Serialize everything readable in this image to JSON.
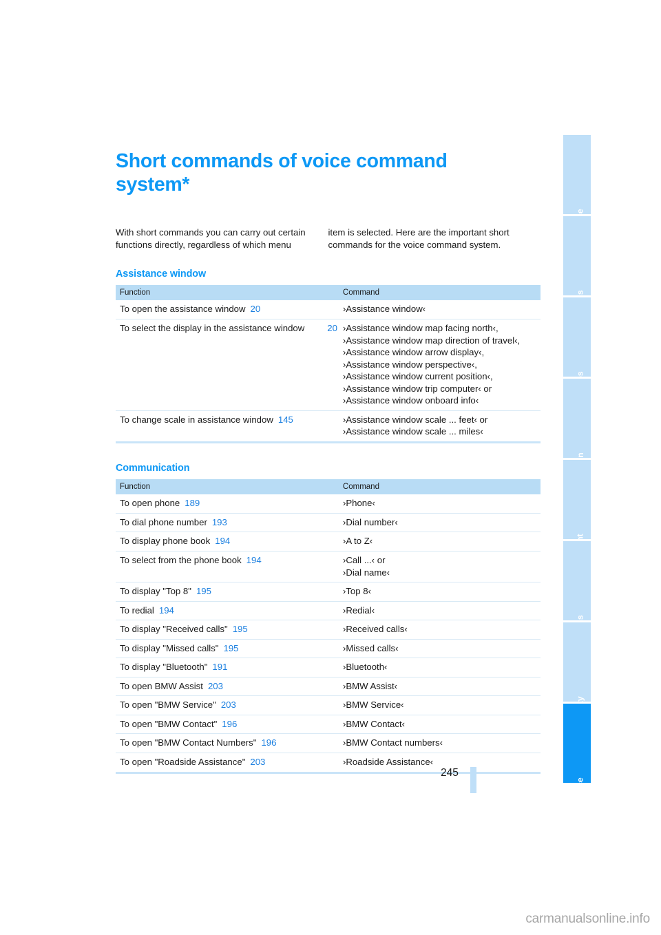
{
  "document": {
    "title": "Short commands of voice command system*",
    "page_number": "245",
    "watermark": "carmanualsonline.info"
  },
  "intro": {
    "left": "With short commands you can carry out certain functions directly, regardless of which menu",
    "right": "item is selected. Here are the important short commands for the voice command system."
  },
  "sections": [
    {
      "heading": "Assistance window",
      "table": {
        "columns": [
          "Function",
          "Command"
        ],
        "rows": [
          {
            "function": "To open the assistance window",
            "pageref": "20",
            "pageref_align": "inline",
            "commands": [
              "›Assistance window‹"
            ]
          },
          {
            "function": "To select the display in the assistance window",
            "pageref": "20",
            "pageref_align": "right",
            "commands": [
              "›Assistance window map facing north‹,",
              "›Assistance window map direction of travel‹,",
              "›Assistance window arrow display‹,",
              "›Assistance window perspective‹,",
              "›Assistance window current position‹,",
              "›Assistance window trip computer‹ or",
              "›Assistance window onboard info‹"
            ]
          },
          {
            "function": "To change scale in assistance window",
            "pageref": "145",
            "pageref_align": "inline",
            "commands": [
              "›Assistance window scale ... feet‹ or",
              "›Assistance window scale ... miles‹"
            ]
          }
        ]
      }
    },
    {
      "heading": "Communication",
      "table": {
        "columns": [
          "Function",
          "Command"
        ],
        "rows": [
          {
            "function": "To open phone",
            "pageref": "189",
            "pageref_align": "inline",
            "commands": [
              "›Phone‹"
            ]
          },
          {
            "function": "To dial phone number",
            "pageref": "193",
            "pageref_align": "inline",
            "commands": [
              "›Dial number‹"
            ]
          },
          {
            "function": "To display phone book",
            "pageref": "194",
            "pageref_align": "inline",
            "commands": [
              "›A to Z‹"
            ]
          },
          {
            "function": "To select from the phone book",
            "pageref": "194",
            "pageref_align": "inline",
            "commands": [
              "›Call ...‹ or",
              "›Dial name‹"
            ]
          },
          {
            "function": "To display \"Top 8\"",
            "pageref": "195",
            "pageref_align": "inline",
            "commands": [
              "›Top 8‹"
            ]
          },
          {
            "function": "To redial",
            "pageref": "194",
            "pageref_align": "inline",
            "commands": [
              "›Redial‹"
            ]
          },
          {
            "function": "To display \"Received calls\"",
            "pageref": "195",
            "pageref_align": "inline",
            "commands": [
              "›Received calls‹"
            ]
          },
          {
            "function": "To display \"Missed calls\"",
            "pageref": "195",
            "pageref_align": "inline",
            "commands": [
              "›Missed calls‹"
            ]
          },
          {
            "function": "To display \"Bluetooth\"",
            "pageref": "191",
            "pageref_align": "inline",
            "commands": [
              "›Bluetooth‹"
            ]
          },
          {
            "function": "To open BMW Assist",
            "pageref": "203",
            "pageref_align": "inline",
            "commands": [
              "›BMW Assist‹"
            ]
          },
          {
            "function": "To open \"BMW Service\"",
            "pageref": "203",
            "pageref_align": "inline",
            "commands": [
              "›BMW Service‹"
            ]
          },
          {
            "function": "To open \"BMW Contact\"",
            "pageref": "196",
            "pageref_align": "inline",
            "commands": [
              "›BMW Contact‹"
            ]
          },
          {
            "function": "To open \"BMW Contact Numbers\"",
            "pageref": "196",
            "pageref_align": "inline",
            "commands": [
              "›BMW Contact numbers‹"
            ]
          },
          {
            "function": "To open \"Roadside Assistance\"",
            "pageref": "203",
            "pageref_align": "inline",
            "commands": [
              "›Roadside Assistance‹"
            ]
          }
        ]
      }
    }
  ],
  "sidetabs": [
    {
      "label": "At a glance",
      "active": false
    },
    {
      "label": "Controls",
      "active": false
    },
    {
      "label": "Driving tips",
      "active": false
    },
    {
      "label": "Navigation",
      "active": false
    },
    {
      "label": "Entertainment",
      "active": false
    },
    {
      "label": "Communications",
      "active": false
    },
    {
      "label": "Mobility",
      "active": false
    },
    {
      "label": "Reference",
      "active": true
    }
  ],
  "colors": {
    "accent_blue": "#0d98f5",
    "table_header_blue": "#b8dcf5",
    "tab_inactive_blue": "#bfdff8",
    "pageref_blue": "#1a7fe0"
  }
}
